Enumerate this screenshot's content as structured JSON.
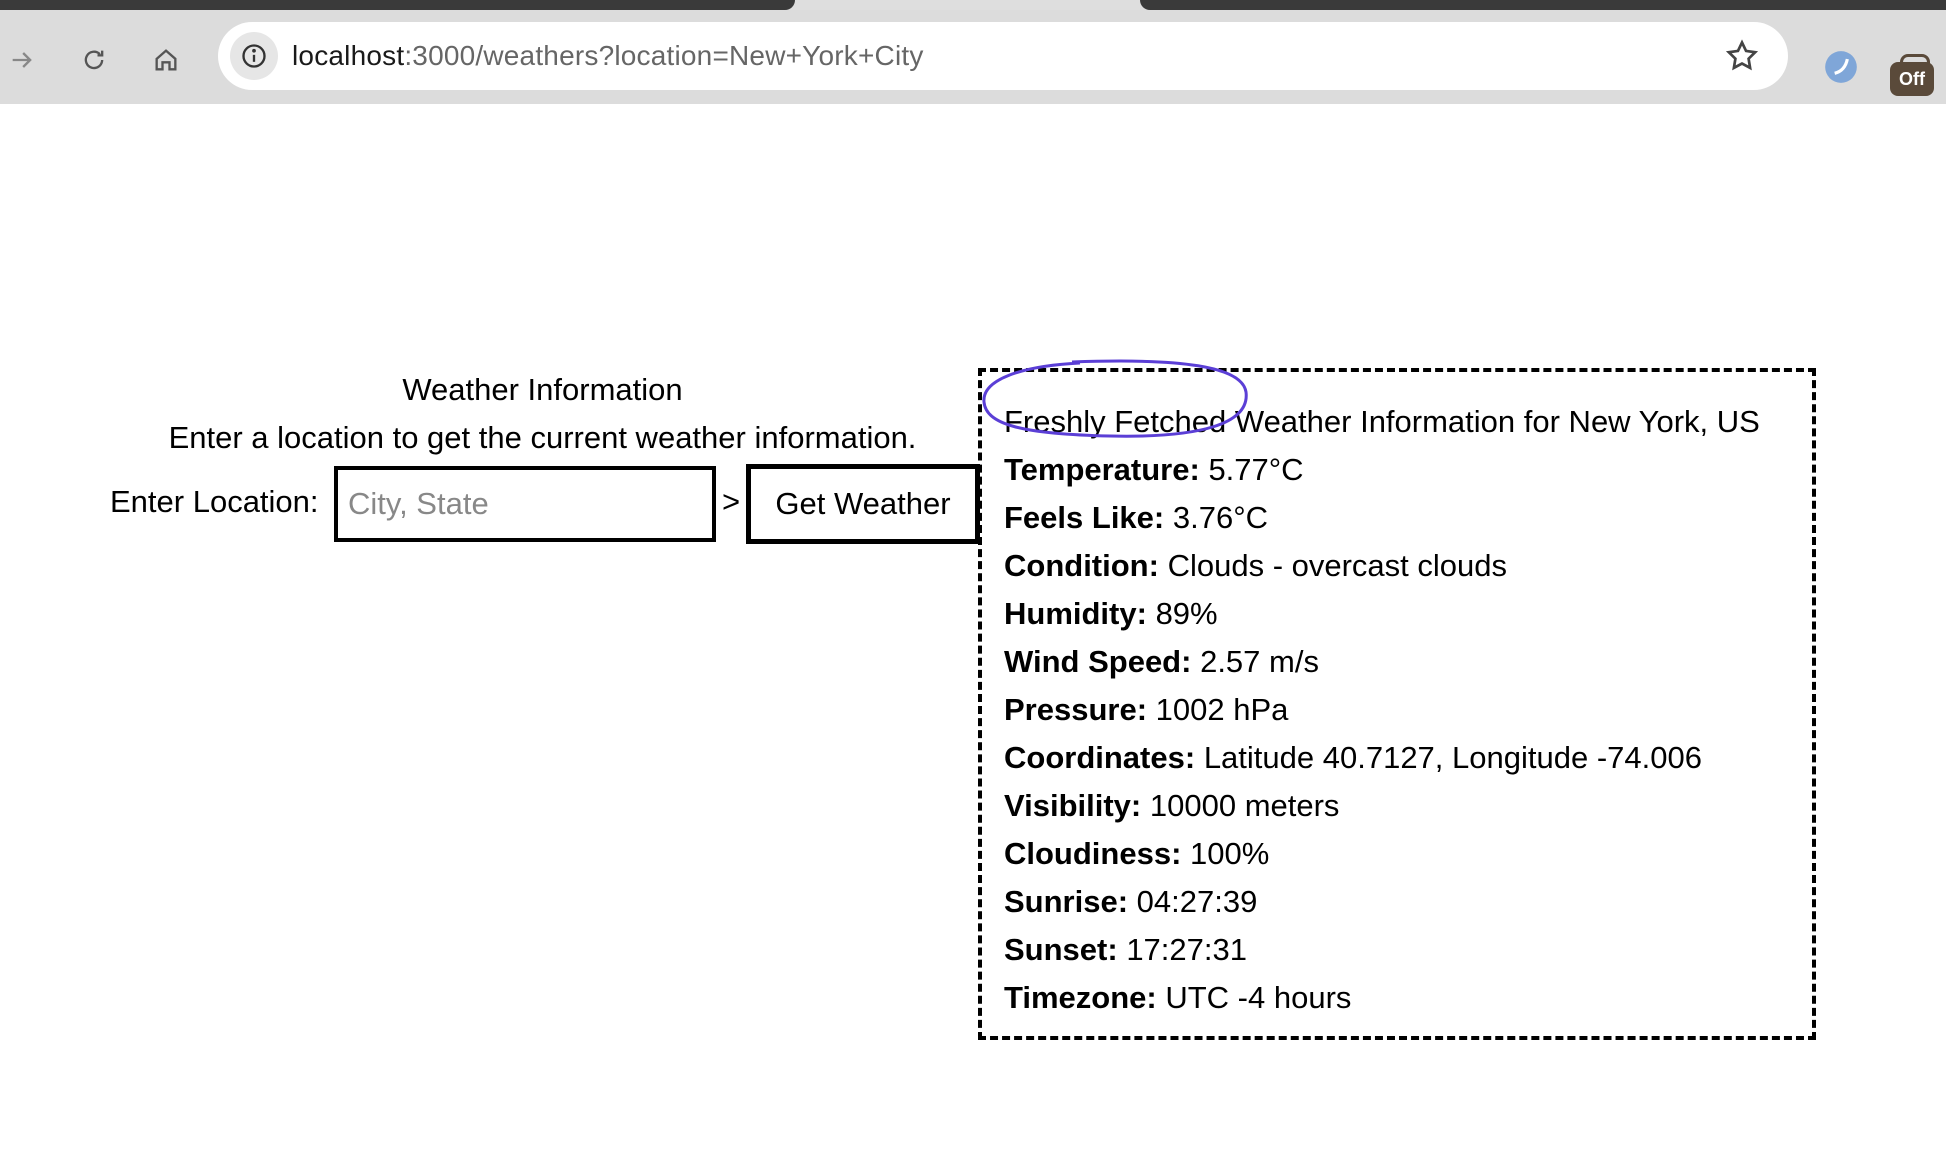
{
  "browser": {
    "url_host": "localhost",
    "url_rest": ":3000/weathers?location=New+York+City",
    "extension_badge": "Off"
  },
  "page": {
    "title": "Weather Information",
    "subtitle": "Enter a location to get the current weather information.",
    "form": {
      "label": "Enter Location:",
      "placeholder": "City, State",
      "arrow": ">",
      "button_label": "Get Weather"
    }
  },
  "weather": {
    "heading": "Freshly Fetched Weather Information for New York, US",
    "rows": [
      {
        "label": "Temperature:",
        "value": "5.77°C"
      },
      {
        "label": "Feels Like:",
        "value": "3.76°C"
      },
      {
        "label": "Condition:",
        "value": "Clouds - overcast clouds"
      },
      {
        "label": "Humidity:",
        "value": "89%"
      },
      {
        "label": "Wind Speed:",
        "value": "2.57 m/s"
      },
      {
        "label": "Pressure:",
        "value": "1002 hPa"
      },
      {
        "label": "Coordinates:",
        "value": "Latitude 40.7127, Longitude -74.006"
      },
      {
        "label": "Visibility:",
        "value": "10000 meters"
      },
      {
        "label": "Cloudiness:",
        "value": "100%"
      },
      {
        "label": "Sunrise:",
        "value": "04:27:39"
      },
      {
        "label": "Sunset:",
        "value": "17:27:31"
      },
      {
        "label": "Timezone:",
        "value": "UTC -4 hours"
      }
    ]
  },
  "colors": {
    "annotation_circle": "#5b3fd6",
    "chrome": "#dcdcdc"
  }
}
